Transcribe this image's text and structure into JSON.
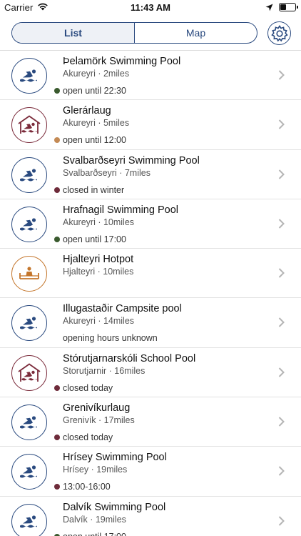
{
  "status_bar": {
    "carrier": "Carrier",
    "time": "11:43 AM"
  },
  "header": {
    "tabs": [
      {
        "label": "List",
        "active": true
      },
      {
        "label": "Map",
        "active": false
      }
    ]
  },
  "colors": {
    "accent": "#2a4a7f",
    "pool_border": "#2a4a7f",
    "natural_border": "#7a2a3a",
    "hotpot_border": "#c4762c",
    "open": "#3a5a2e",
    "closed": "#6e2b3a",
    "limited": "#c48a55"
  },
  "pools": [
    {
      "name": "Þelamörk Swimming Pool",
      "location": "Akureyri",
      "distance": "2miles",
      "status": "open until 22:30",
      "status_color": "#3a5a2e",
      "icon": "pool-swimmer-icon",
      "icon_color": "#2a4a7f"
    },
    {
      "name": "Glerárlaug",
      "location": "Akureyri",
      "distance": "5miles",
      "status": "open until 12:00",
      "status_color": "#c48a55",
      "icon": "indoor-pool-icon",
      "icon_color": "#7a2a3a"
    },
    {
      "name": "Svalbarðseyri Swimming Pool",
      "location": "Svalbarðseyri",
      "distance": "7miles",
      "status": "closed in winter",
      "status_color": "#6e2b3a",
      "icon": "pool-swimmer-icon",
      "icon_color": "#2a4a7f"
    },
    {
      "name": "Hrafnagil Swimming Pool",
      "location": "Akureyri",
      "distance": "10miles",
      "status": "open until 17:00",
      "status_color": "#3a5a2e",
      "icon": "pool-swimmer-icon",
      "icon_color": "#2a4a7f"
    },
    {
      "name": "Hjalteyri Hotpot",
      "location": "Hjalteyri",
      "distance": "10miles",
      "status": "",
      "status_color": "",
      "icon": "hotpot-icon",
      "icon_color": "#c4762c"
    },
    {
      "name": "Illugastaðir Campsite pool",
      "location": "Akureyri",
      "distance": "14miles",
      "status": "opening hours unknown",
      "status_color": "",
      "icon": "pool-swimmer-icon",
      "icon_color": "#2a4a7f"
    },
    {
      "name": "Stórutjarnarskóli School Pool",
      "location": "Storutjarnir",
      "distance": "16miles",
      "status": "closed today",
      "status_color": "#6e2b3a",
      "icon": "indoor-pool-icon",
      "icon_color": "#7a2a3a"
    },
    {
      "name": "Grenivíkurlaug",
      "location": "Grenivík",
      "distance": "17miles",
      "status": "closed today",
      "status_color": "#6e2b3a",
      "icon": "pool-swimmer-icon",
      "icon_color": "#2a4a7f"
    },
    {
      "name": "Hrísey Swimming Pool",
      "location": "Hrísey",
      "distance": "19miles",
      "status": "13:00-16:00",
      "status_color": "#6e2b3a",
      "icon": "pool-swimmer-icon",
      "icon_color": "#2a4a7f"
    },
    {
      "name": "Dalvík Swimming Pool",
      "location": "Dalvík",
      "distance": "19miles",
      "status": "open until 17:00",
      "status_color": "#3a5a2e",
      "icon": "pool-swimmer-icon",
      "icon_color": "#2a4a7f"
    }
  ]
}
